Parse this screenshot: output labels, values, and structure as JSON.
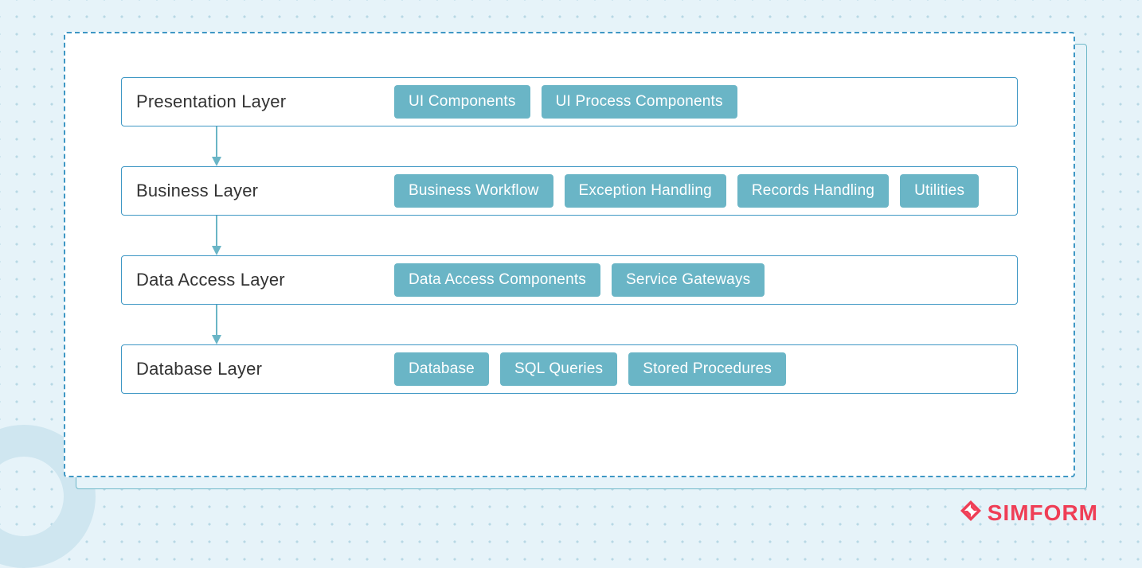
{
  "brand": {
    "name": "SIMFORM"
  },
  "colors": {
    "accent": "#6ab5c6",
    "border": "#3e97c4",
    "brand": "#ef3e56"
  },
  "layers": [
    {
      "title": "Presentation Layer",
      "components": [
        "UI Components",
        "UI Process Components"
      ]
    },
    {
      "title": "Business Layer",
      "components": [
        "Business Workflow",
        "Exception Handling",
        "Records Handling",
        "Utilities"
      ]
    },
    {
      "title": "Data Access Layer",
      "components": [
        "Data Access Components",
        "Service Gateways"
      ]
    },
    {
      "title": "Database Layer",
      "components": [
        "Database",
        "SQL Queries",
        "Stored Procedures"
      ]
    }
  ]
}
